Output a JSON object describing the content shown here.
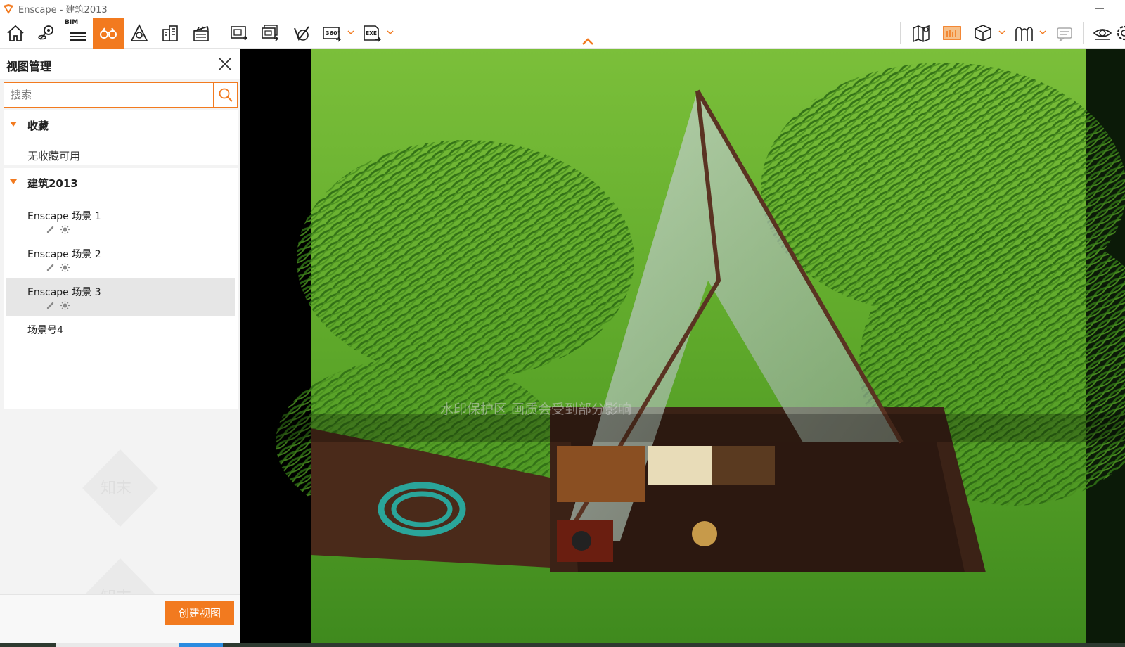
{
  "window": {
    "title": "Enscape - 建筑2013"
  },
  "toolbar": {
    "bim_label": "BIM",
    "buttons": [
      {
        "icon": "home-icon"
      },
      {
        "icon": "location-pin-icon"
      },
      {
        "icon": "bim-icon"
      },
      {
        "icon": "binoculars-icon",
        "active": true
      },
      {
        "icon": "sun-pyramid-icon"
      },
      {
        "icon": "buildings-icon"
      },
      {
        "icon": "clapperboard-icon"
      },
      {
        "icon": "screenshot-icon"
      },
      {
        "icon": "batch-render-icon"
      },
      {
        "icon": "upload-icon"
      },
      {
        "icon": "panorama-360-icon"
      },
      {
        "icon": "exe-export-icon"
      },
      {
        "icon": "map-icon"
      },
      {
        "icon": "asset-library-icon"
      },
      {
        "icon": "cube-icon"
      },
      {
        "icon": "sections-icon"
      },
      {
        "icon": "collaboration-icon"
      },
      {
        "icon": "eye-icon"
      },
      {
        "icon": "settings-icon"
      }
    ],
    "accent_color": "#f27a1f"
  },
  "panel": {
    "title": "视图管理",
    "search": {
      "placeholder": "搜索",
      "value": ""
    },
    "favorites": {
      "label": "收藏",
      "empty_text": "无收藏可用"
    },
    "project": {
      "label": "建筑2013",
      "views": [
        {
          "name": "Enscape 场景 1",
          "selected": false
        },
        {
          "name": "Enscape 场景 2",
          "selected": false
        },
        {
          "name": "Enscape 场景 3",
          "selected": true
        },
        {
          "name": "场景号4",
          "selected": false
        }
      ]
    },
    "create_button": "创建视图",
    "watermark": "知末"
  },
  "viewport": {
    "watermark_notice": "水印保护区  画质会受到部分影响",
    "watermark_logo": "知末"
  }
}
